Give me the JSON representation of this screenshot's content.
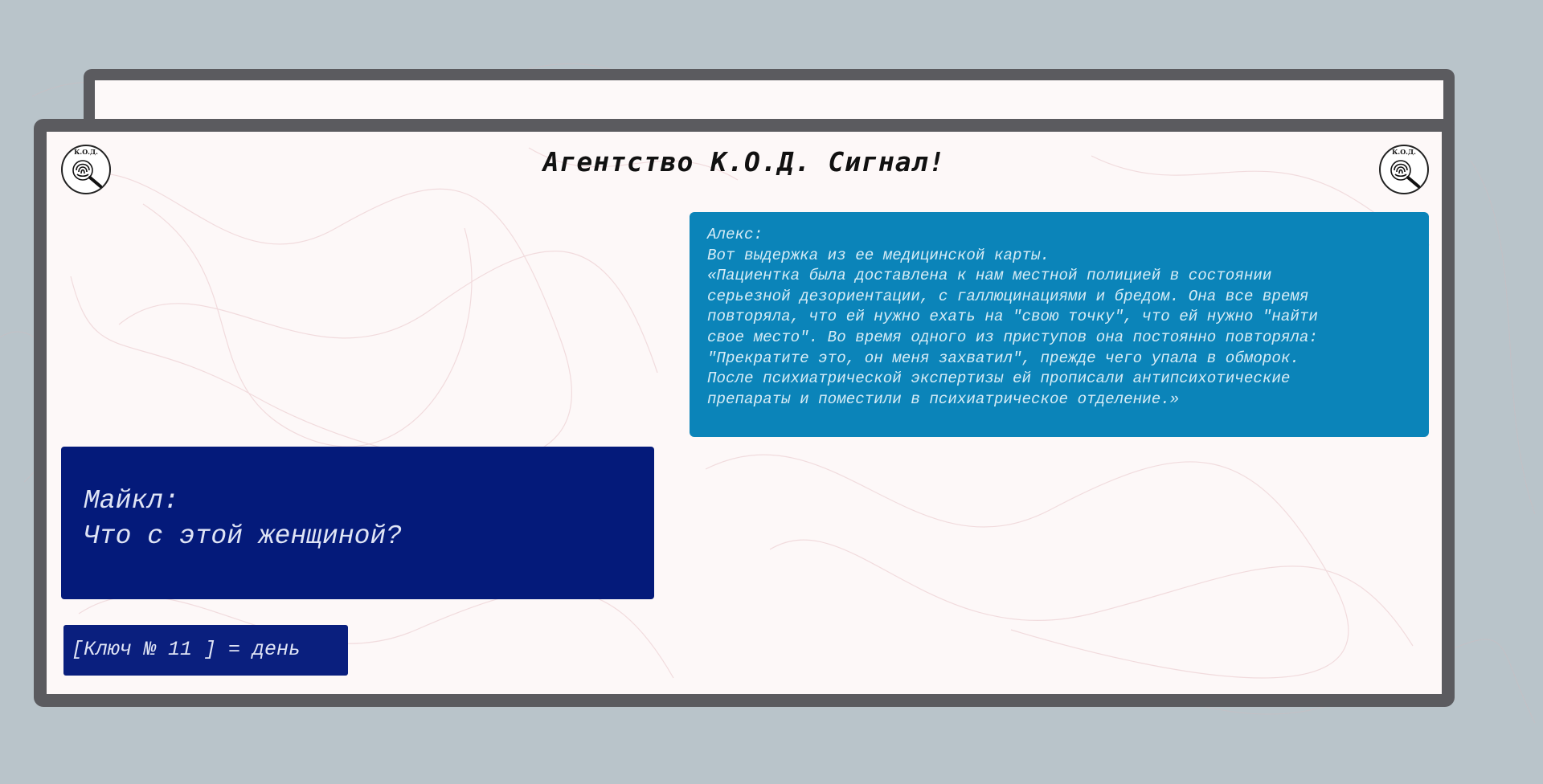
{
  "header": {
    "title": "Агентство К.О.Д. Сигнал!",
    "logo_text": "К.О.Д."
  },
  "alex": {
    "speaker": "Алекс:",
    "lines": [
      "Вот выдержка из ее медицинской карты.",
      "«Пациентка была доставлена к нам местной полицией в состоянии",
      "серьезной дезориентации, с галлюцинациями и бредом. Она все время",
      "повторяла, что ей нужно ехать на \"свою точку\", что ей нужно \"найти",
      "свое место\". Во время одного из приступов она постоянно повторяла:",
      "\"Прекратите это, он меня захватил\", прежде чего упала в обморок.",
      "После психиатрической экспертизы ей прописали антипсихотические",
      "препараты и поместили в психиатрическое отделение.»"
    ]
  },
  "michael": {
    "speaker": "Майкл:",
    "text": "Что с этой женщиной?"
  },
  "key": {
    "text": "[Ключ № 11 ] = день"
  },
  "colors": {
    "page_bg": "#b9c4ca",
    "frame": "#5b5b5f",
    "alex_bubble": "#0b84b9",
    "michael_bubble": "#041a7a",
    "key_box": "#0a1f7e"
  }
}
